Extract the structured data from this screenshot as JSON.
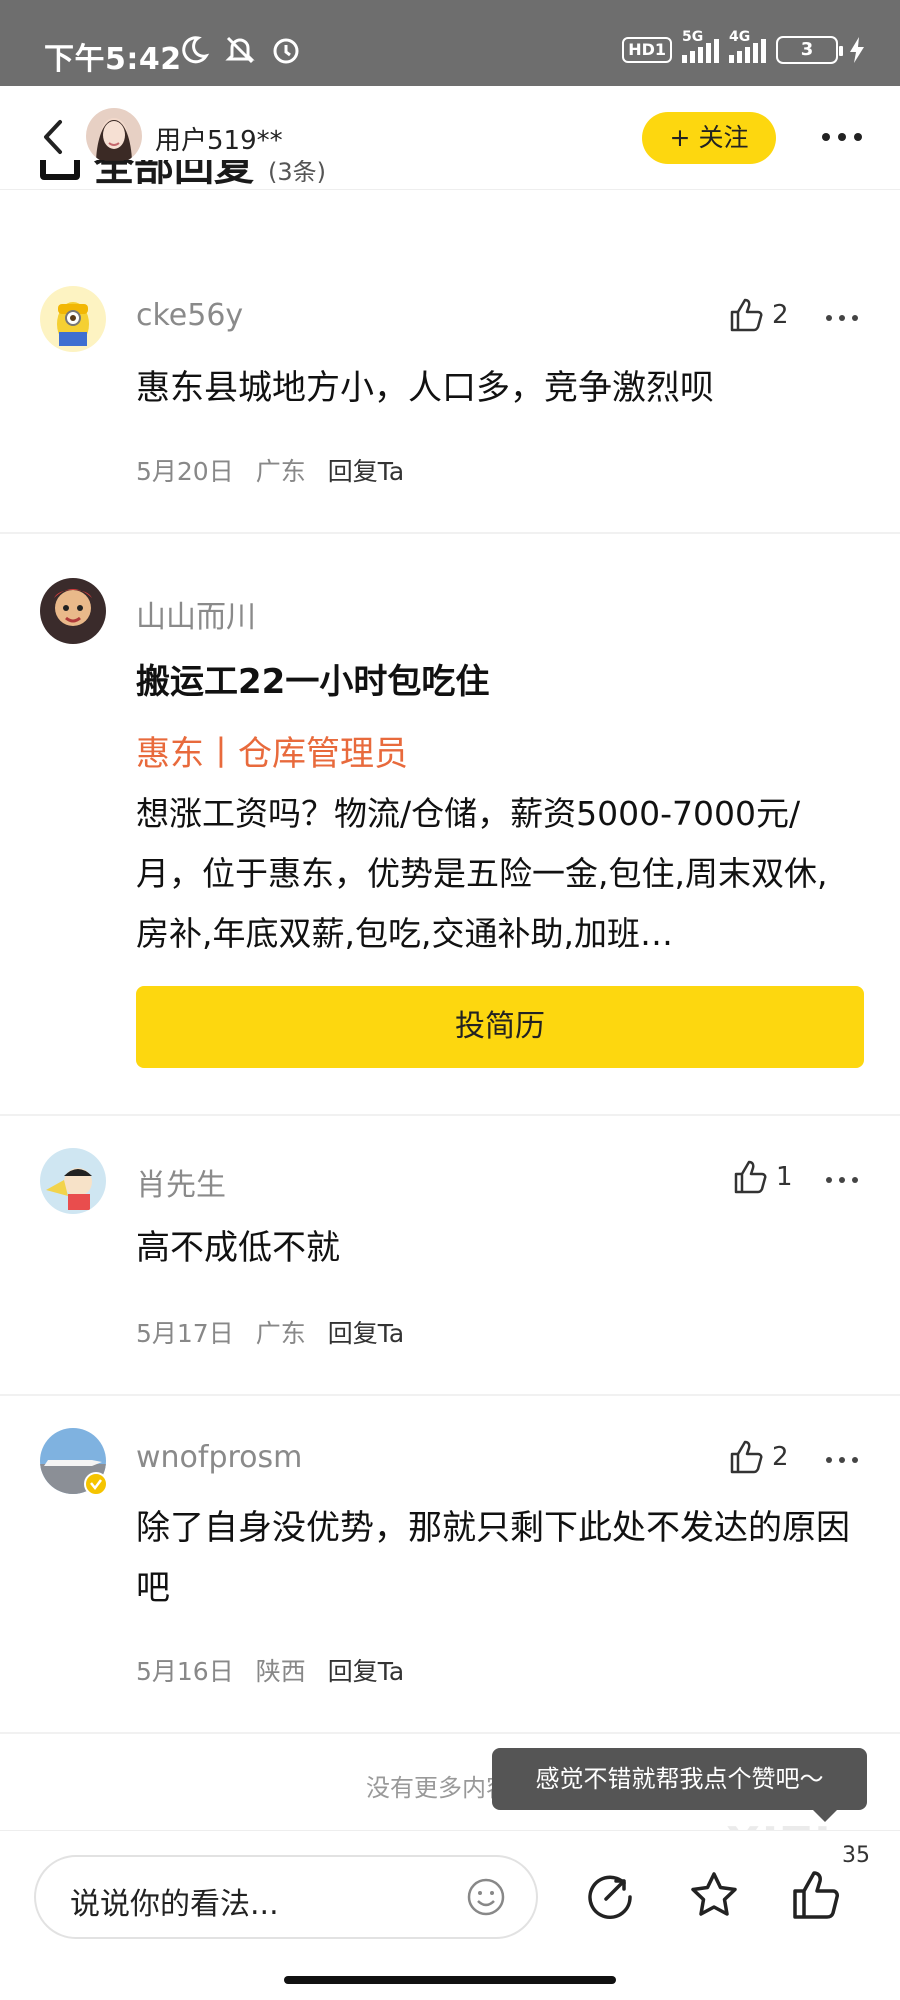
{
  "status_bar": {
    "time": "下午5:42",
    "hd": "HD1",
    "net1": "5G",
    "net2": "4G",
    "battery": "3"
  },
  "nav": {
    "username": "用户519**",
    "follow_label": "+ 关注"
  },
  "section": {
    "title": "全部回复",
    "count": "(3条)"
  },
  "comments": [
    {
      "user": "cke56y",
      "text": "惠东县城地方小，人口多，竞争激烈呗",
      "likes": "2",
      "date": "5月20日",
      "region": "广东",
      "reply": "回复Ta"
    },
    {
      "user": "肖先生",
      "text": "高不成低不就",
      "likes": "1",
      "date": "5月17日",
      "region": "广东",
      "reply": "回复Ta"
    },
    {
      "user": "wnofprosm",
      "text": "除了自身没优势，那就只剩下此处不发达的原因吧",
      "likes": "2",
      "date": "5月16日",
      "region": "陕西",
      "reply": "回复Ta"
    }
  ],
  "ad": {
    "user": "山山而川",
    "title": "搬运工22一小时包吃住",
    "job": "惠东丨仓库管理员",
    "body": "想涨工资吗？物流/仓储，薪资5000-7000元/月，位于惠东，优势是五险一金,包住,周末双休,房补,年底双薪,包吃,交通补助,加班…",
    "button": "投简历"
  },
  "footer": {
    "no_more": "没有更多内容了",
    "toast": "感觉不错就帮我点个赞吧～",
    "watermark": "XIZI"
  },
  "bottom_bar": {
    "placeholder": "说说你的看法...",
    "like_count": "35"
  }
}
